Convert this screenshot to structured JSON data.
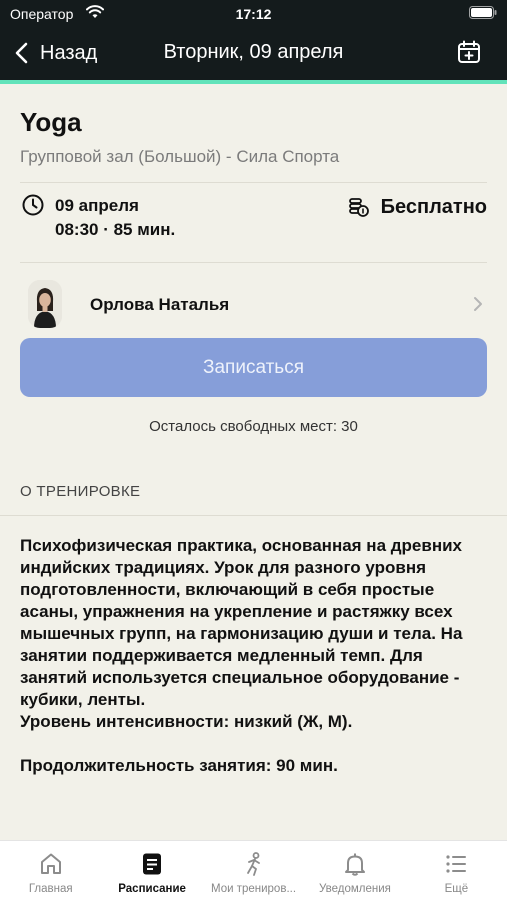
{
  "status_bar": {
    "carrier": "Оператор",
    "time": "17:12"
  },
  "nav": {
    "back_label": "Назад",
    "title": "Вторник, 09 апреля"
  },
  "class": {
    "title": "Yoga",
    "location": "Групповой зал (Большой) - Сила Спорта",
    "date": "09 апреля",
    "time": "08:30 · 85 мин.",
    "price": "Бесплатно"
  },
  "trainer": {
    "name": "Орлова Наталья"
  },
  "enroll_button": "Записаться",
  "seats_left": "Осталось свободных мест: 30",
  "about": {
    "header": "О ТРЕНИРОВКЕ",
    "text": "Психофизическая практика, основанная на древних индийских традициях. Урок для разного уровня подготовленности, включающий в себя простые асаны, упражнения на укрепление и растяжку всех мышечных групп, на гармонизацию души и тела. На занятии поддерживается медленный темп. Для занятий используется специальное оборудование - кубики, ленты.\nУровень интенсивности: низкий (Ж, М).\n\nПродолжительность занятия: 90 мин."
  },
  "tabs": [
    {
      "label": "Главная",
      "icon": "home-icon",
      "active": false
    },
    {
      "label": "Расписание",
      "icon": "schedule-icon",
      "active": true
    },
    {
      "label": "Мои трениров...",
      "icon": "workout-icon",
      "active": false
    },
    {
      "label": "Уведомления",
      "icon": "bell-icon",
      "active": false
    },
    {
      "label": "Ещё",
      "icon": "menu-icon",
      "active": false
    }
  ],
  "colors": {
    "accent": "#62e3ba",
    "top_bar": "#141b1c",
    "button": "#869ed9",
    "background": "#f2f1e9"
  }
}
